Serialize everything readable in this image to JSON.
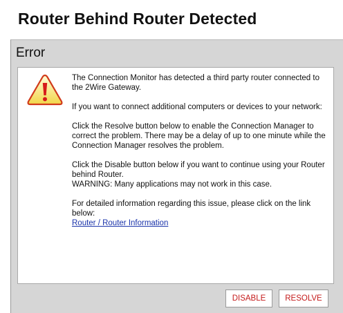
{
  "page": {
    "title": "Router Behind Router Detected"
  },
  "panel": {
    "heading": "Error",
    "icon": "warning-triangle-icon",
    "paragraphs": [
      "The Connection Monitor has detected a third party router connected to the 2Wire Gateway.",
      "If you want to connect additional computers or devices to your network:",
      "Click the Resolve button below to enable the Connection Manager to correct the problem. There may be a delay of up to one minute while the Connection Manager resolves the problem.",
      "Click the Disable button below if you want to continue using your Router behind Router.",
      "WARNING: Many applications may not work in this case.",
      "For detailed information regarding this issue, please click on the link below:"
    ],
    "link_text": "Router / Router Information"
  },
  "buttons": {
    "disable_label": "DISABLE",
    "resolve_label": "RESOLVE"
  },
  "colors": {
    "button_text": "#c41a1a",
    "link": "#1a33aa",
    "panel_background": "#d6d6d6",
    "icon_fill": "#f7e66a",
    "icon_mark": "#d61a1a"
  }
}
